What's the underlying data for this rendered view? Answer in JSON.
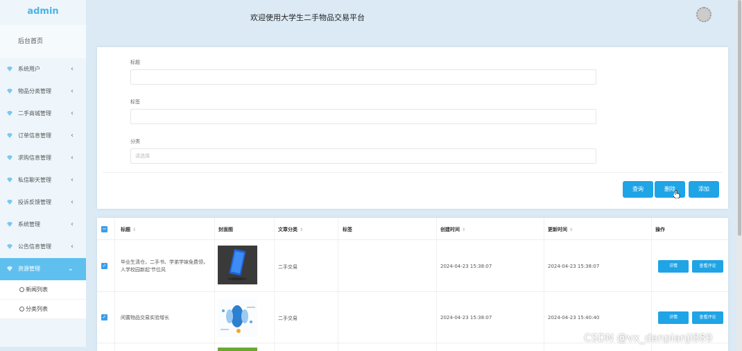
{
  "app": {
    "logo": "admin",
    "title": "欢迎使用大学生二手物品交易平台"
  },
  "sidebar": {
    "home": "后台首页",
    "items": [
      {
        "label": "系统用户"
      },
      {
        "label": "物品分类管理"
      },
      {
        "label": "二手商城管理"
      },
      {
        "label": "订单信息管理"
      },
      {
        "label": "求购信息管理"
      },
      {
        "label": "私信聊天管理"
      },
      {
        "label": "投诉反馈管理"
      },
      {
        "label": "系统管理"
      },
      {
        "label": "公告信息管理"
      },
      {
        "label": "资源管理"
      }
    ],
    "subitems": [
      {
        "label": "新闻列表"
      },
      {
        "label": "分类列表"
      }
    ],
    "active_color": "#5fc0ef"
  },
  "form": {
    "title_label": "标题",
    "title_value": "",
    "tag_label": "标签",
    "tag_value": "",
    "category_label": "分类",
    "category_placeholder": "请选择"
  },
  "actions": {
    "search": "查询",
    "delete": "删除",
    "add": "添加"
  },
  "table": {
    "headers": {
      "title": "标题",
      "cover": "封面图",
      "category": "文章分类",
      "tags": "标签",
      "created": "创建时间",
      "updated": "更新时间",
      "ops": "操作"
    },
    "rows": [
      {
        "title": "毕业生清仓，二手书、学弟学妹免费领，人学校园新起'节位风",
        "category": "二手交易",
        "tags": "",
        "created": "2024-04-23 15:38:07",
        "updated": "2024-04-23 15:38:07",
        "checked": true
      },
      {
        "title": "闲置物品交易实验增长",
        "category": "二手交易",
        "tags": "",
        "created": "2024-04-23 15:38:07",
        "updated": "2024-04-23 15:40:40",
        "checked": true
      }
    ],
    "detail_btn": "详情",
    "comment_btn": "查看评论"
  },
  "watermark": "CSDN @vx_danpianji889",
  "colors": {
    "primary": "#1fa4e6",
    "accent": "#4ab3e8"
  }
}
